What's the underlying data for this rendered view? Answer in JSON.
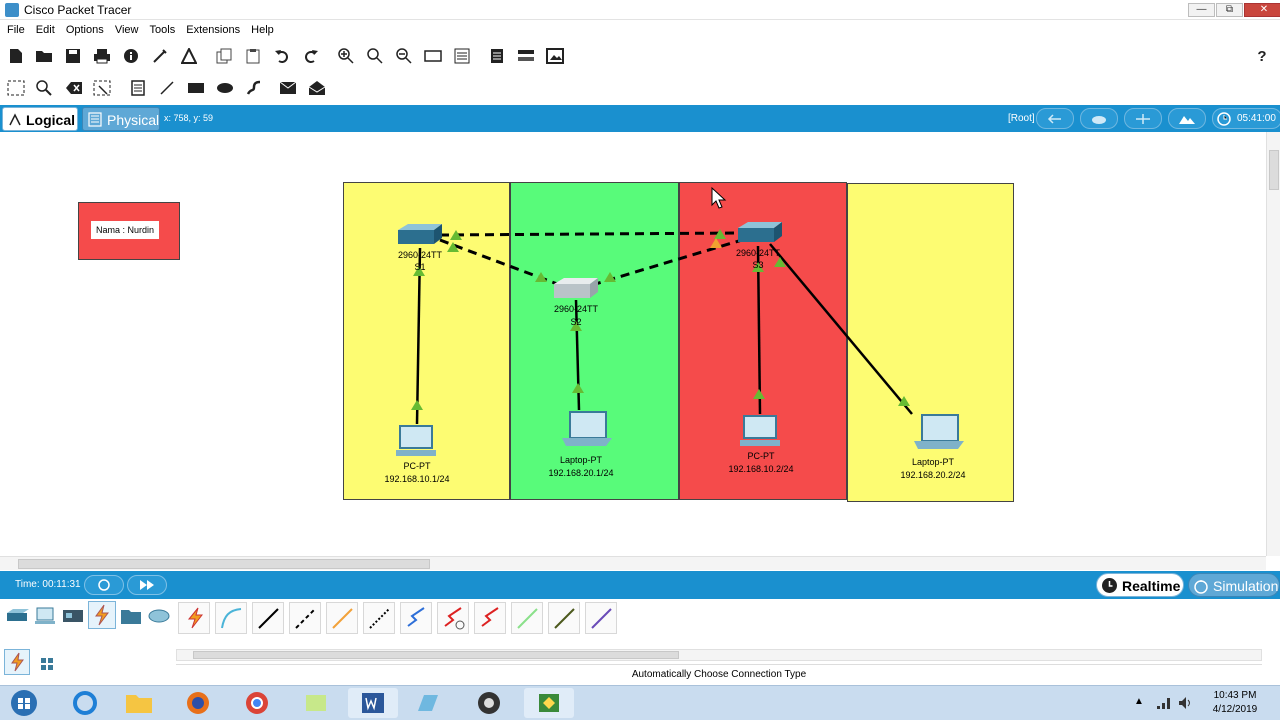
{
  "window": {
    "title": "Cisco Packet Tracer",
    "min": "—",
    "max": "⧉",
    "close": "✕"
  },
  "menu": [
    "File",
    "Edit",
    "Options",
    "View",
    "Tools",
    "Extensions",
    "Help"
  ],
  "toolbar1": {
    "help_label": "?"
  },
  "viewbar": {
    "logical_label": "Logical",
    "physical_label": "Physical",
    "coords": "x: 758, y: 59",
    "root_label": "[Root]",
    "clock": "05:41:00"
  },
  "workspace": {
    "note": "Nama : Nurdin",
    "zone_colors": {
      "yellow": "#fdfc72",
      "green": "#58fb7a",
      "red": "#f54b4b"
    },
    "devices": {
      "s1": {
        "model": "2960-24TT",
        "name": "S1"
      },
      "s2": {
        "model": "2960-24TT",
        "name": "S2"
      },
      "s3": {
        "model": "2960-24TT",
        "name": "S3"
      },
      "pc1": {
        "type": "PC-PT",
        "ip": "192.168.10.1/24"
      },
      "laptop1": {
        "type": "Laptop-PT",
        "ip": "192.168.20.1/24"
      },
      "pc2": {
        "type": "PC-PT",
        "ip": "192.168.10.2/24"
      },
      "laptop2": {
        "type": "Laptop-PT",
        "ip": "192.168.20.2/24"
      }
    }
  },
  "timebar": {
    "time": "Time: 00:11:31",
    "realtime_label": "Realtime",
    "simulation_label": "Simulation"
  },
  "palette": {
    "caption": "Automatically Choose Connection Type"
  },
  "taskbar": {
    "time": "10:43 PM",
    "date": "4/12/2019"
  }
}
